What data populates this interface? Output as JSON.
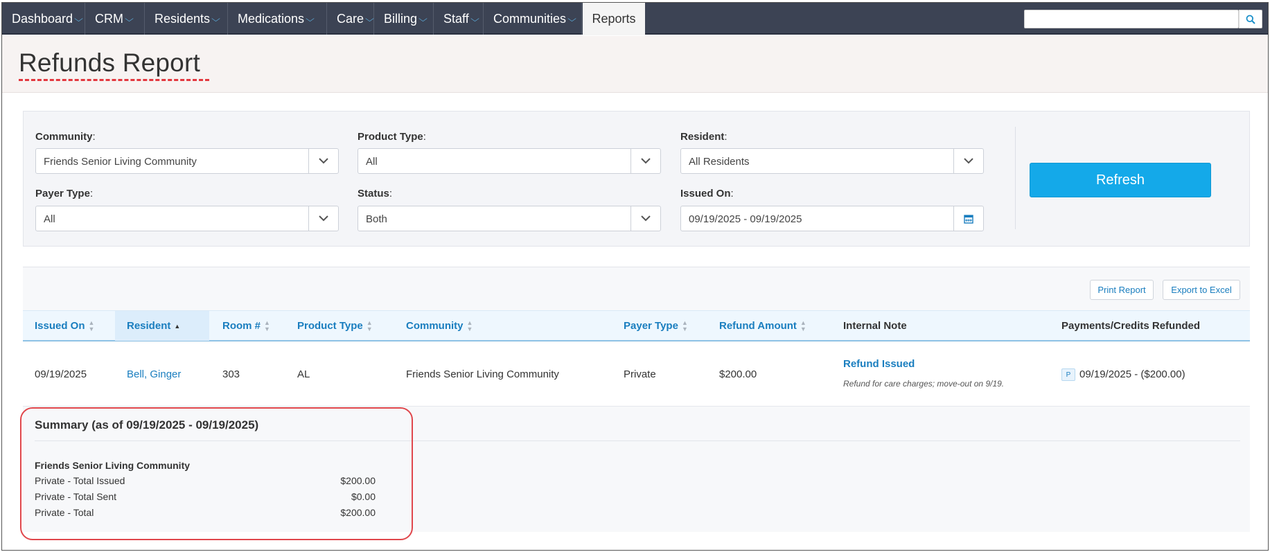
{
  "nav": {
    "items": [
      {
        "label": "Dashboard",
        "chevron": true
      },
      {
        "label": "CRM",
        "chevron": true
      },
      {
        "label": "Residents",
        "chevron": true
      },
      {
        "label": "Medications",
        "chevron": true
      },
      {
        "label": "Care",
        "chevron": true
      },
      {
        "label": "Billing",
        "chevron": true
      },
      {
        "label": "Staff",
        "chevron": true
      },
      {
        "label": "Communities",
        "chevron": true
      },
      {
        "label": "Reports",
        "chevron": false,
        "active": true
      }
    ],
    "search_value": "",
    "icons": {
      "search": "search-icon",
      "chevron": "chevron-down-icon"
    }
  },
  "header": {
    "title": "Refunds Report"
  },
  "filters": {
    "community": {
      "label": "Community",
      "value": "Friends Senior Living Community"
    },
    "product_type": {
      "label": "Product Type",
      "value": "All"
    },
    "resident": {
      "label": "Resident",
      "value": "All Residents"
    },
    "payer_type": {
      "label": "Payer Type",
      "value": "All"
    },
    "status": {
      "label": "Status",
      "value": "Both"
    },
    "issued_on": {
      "label": "Issued On",
      "value": "09/19/2025 - 09/19/2025"
    },
    "colon": ":",
    "refresh_label": "Refresh"
  },
  "toolbar": {
    "print_label": "Print Report",
    "export_label": "Export to Excel"
  },
  "table": {
    "headers": {
      "issued_on": "Issued On",
      "resident": "Resident",
      "room": "Room #",
      "product_type": "Product Type",
      "community": "Community",
      "payer_type": "Payer Type",
      "refund_amount": "Refund Amount",
      "internal_note": "Internal Note",
      "payments": "Payments/Credits Refunded"
    },
    "rows": [
      {
        "issued_on": "09/19/2025",
        "resident": "Bell, Ginger",
        "room": "303",
        "product_type": "AL",
        "community": "Friends Senior Living Community",
        "payer_type": "Private",
        "refund_amount": "$200.00",
        "note_title": "Refund Issued",
        "note_text": "Refund for care charges; move-out on 9/19.",
        "payment_badge": "P",
        "payment": "09/19/2025 - ($200.00)"
      }
    ]
  },
  "summary": {
    "title": "Summary (as of 09/19/2025 - 09/19/2025)",
    "community": "Friends Senior Living Community",
    "lines": [
      {
        "label": "Private - Total Issued",
        "value": "$200.00"
      },
      {
        "label": "Private - Total Sent",
        "value": "$0.00"
      },
      {
        "label": "Private - Total",
        "value": "$200.00"
      }
    ]
  },
  "colors": {
    "nav_bg": "#3c4354",
    "accent": "#14a9e9",
    "link": "#1a7ebf",
    "annotation": "#e0474c"
  }
}
